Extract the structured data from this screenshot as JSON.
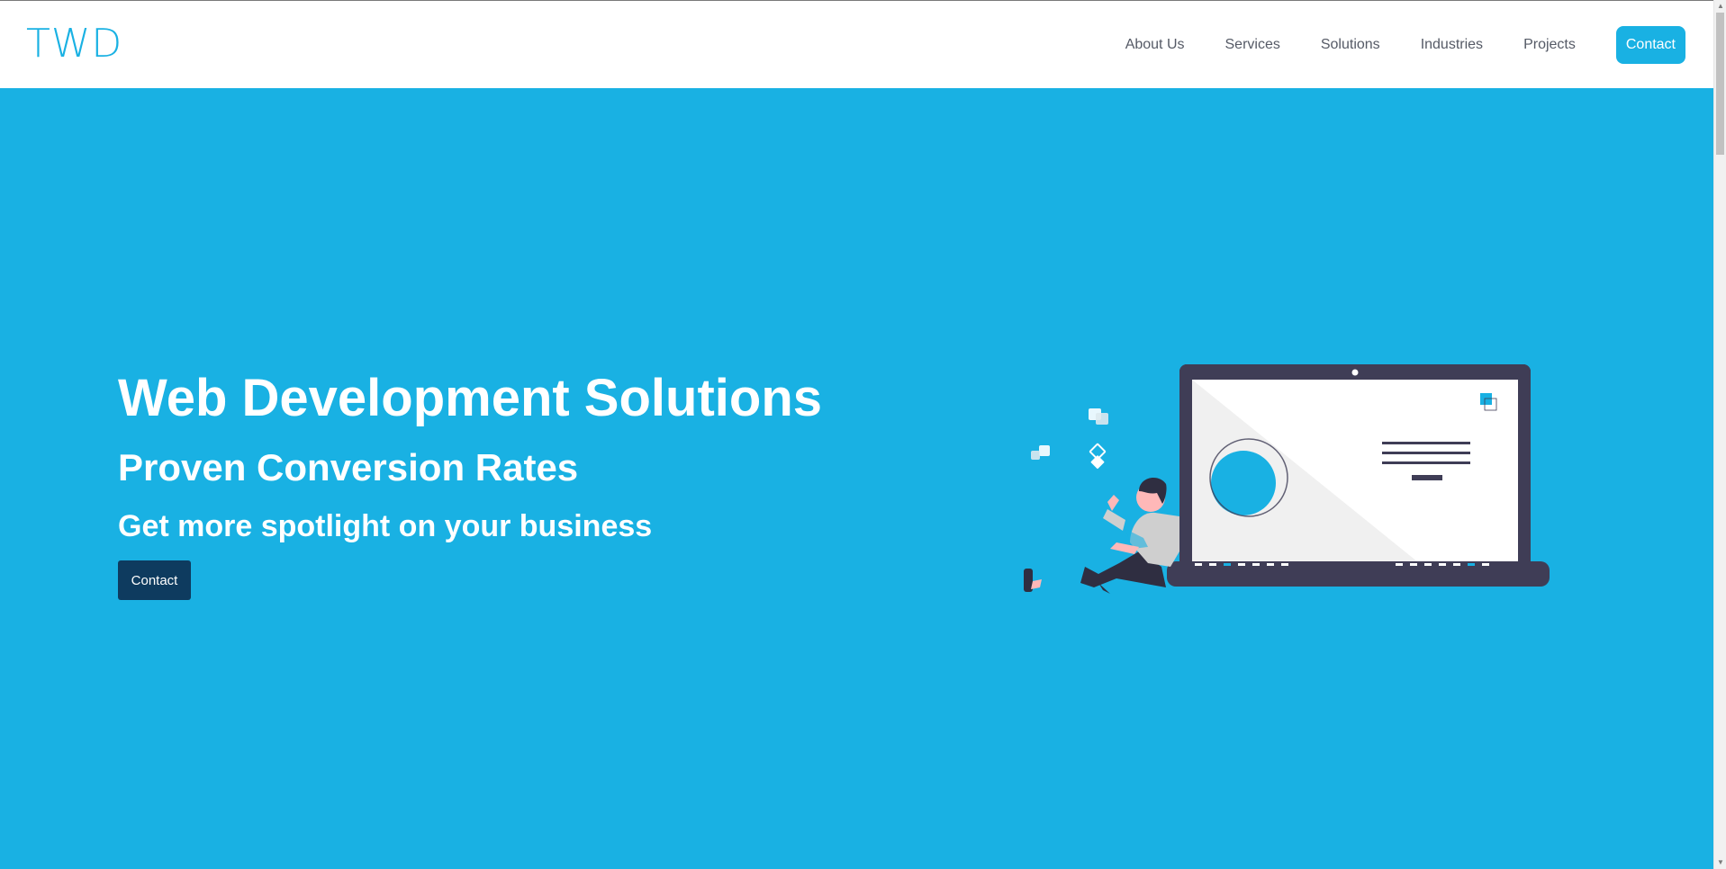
{
  "brand": {
    "logo": "TWD",
    "accent": "#19b1e3",
    "dark_button": "#0e3b5f"
  },
  "nav": {
    "items": [
      {
        "label": "About Us"
      },
      {
        "label": "Services"
      },
      {
        "label": "Solutions"
      },
      {
        "label": "Industries"
      },
      {
        "label": "Projects"
      }
    ],
    "cta_label": "Contact"
  },
  "hero": {
    "title": "Web Development Solutions",
    "subtitle": "Proven Conversion Rates",
    "tagline": "Get more spotlight on your business",
    "cta_label": "Contact",
    "illustration": "person-with-laptop-illustration"
  }
}
